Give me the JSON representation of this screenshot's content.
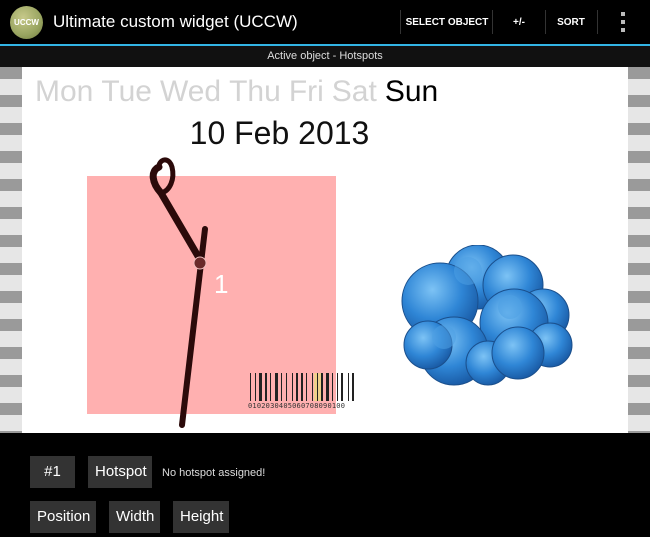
{
  "actionbar": {
    "logo_text": "UCCW",
    "title": "Ultimate custom widget (UCCW)",
    "select_object_label": "SELECT OBJECT",
    "plus_minus_label": "+/-",
    "sort_label": "SORT",
    "accent_color": "#33b5e5"
  },
  "subtitle": "Active object - Hotspots",
  "canvas": {
    "days": [
      "Mon",
      "Tue",
      "Wed",
      "Thu",
      "Fri",
      "Sat",
      "Sun"
    ],
    "current_day": "Sun",
    "date_text": "10 Feb 2013",
    "hand_label": "1",
    "barcode_digits": "0102030405060708090100",
    "hotspot_color": "#ff9696",
    "weather_icon": "cloud-icon"
  },
  "panel": {
    "index_label": "#1",
    "hotspot_label": "Hotspot",
    "hotspot_status": "No hotspot assigned!",
    "position_label": "Position",
    "width_label": "Width",
    "height_label": "Height"
  }
}
